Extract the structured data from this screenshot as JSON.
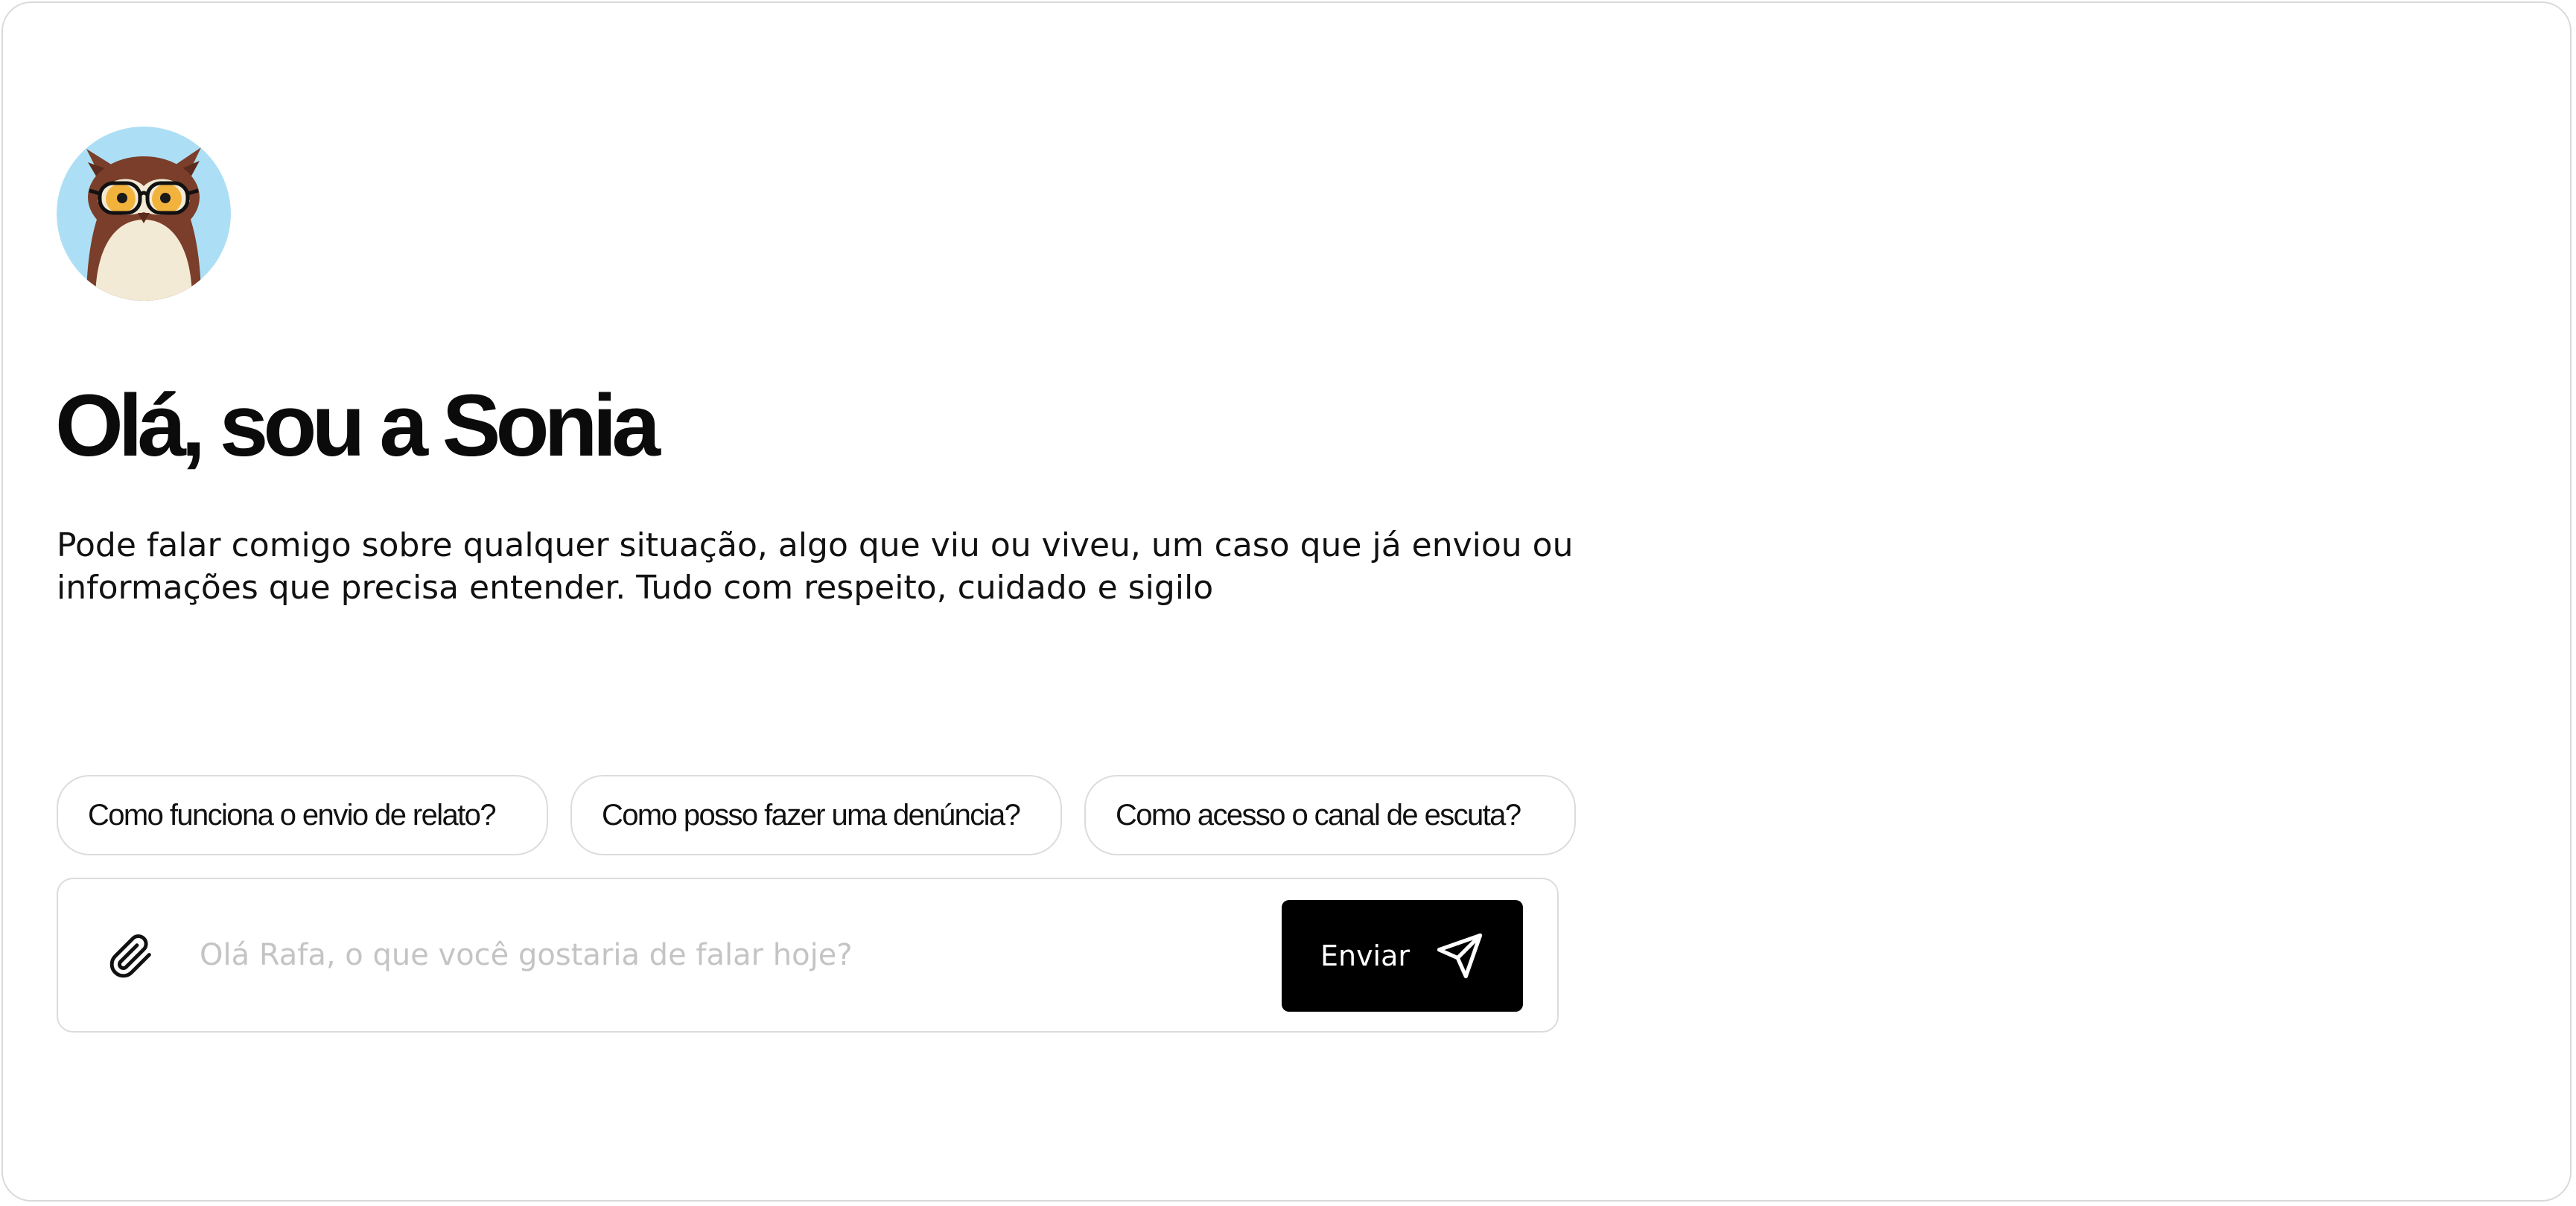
{
  "assistant": {
    "avatar_icon": "owl-mascot-icon",
    "greeting": "Olá, sou a Sonia",
    "intro": "Pode falar comigo sobre qualquer situação, algo que viu ou viveu, um caso que já enviou ou informações que precisa entender. Tudo com respeito, cuidado e sigilo"
  },
  "suggestions": [
    {
      "label": "Como funciona o envio de relato?"
    },
    {
      "label": "Como posso fazer uma denúncia?"
    },
    {
      "label": "Como acesso o canal de escuta?"
    }
  ],
  "composer": {
    "attach_icon": "paperclip-icon",
    "input_value": "",
    "placeholder": "Olá Rafa, o que você gostaria de falar hoje?",
    "send_label": "Enviar",
    "send_icon": "paper-plane-icon"
  },
  "colors": {
    "avatar_background": "#ACDFF5",
    "owl_brown": "#7A3E2A",
    "owl_belly": "#F3EAD6",
    "owl_eyes": "#F2B33D",
    "send_button": "#000000",
    "border": "#DCDCDC"
  }
}
